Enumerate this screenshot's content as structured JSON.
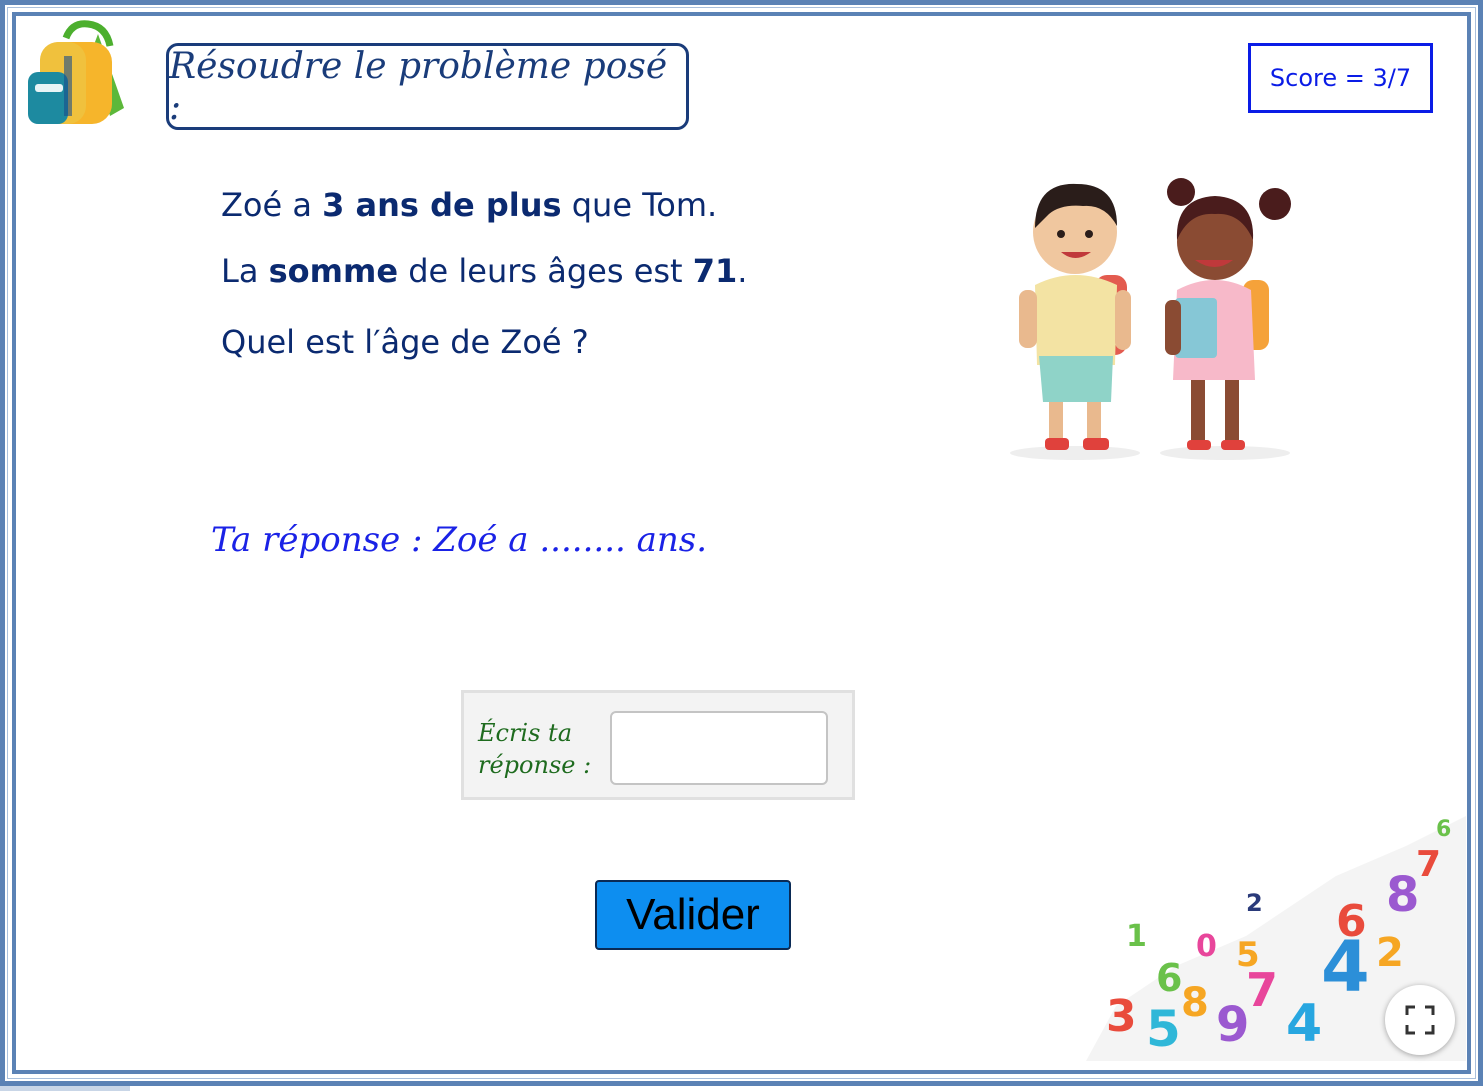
{
  "header": {
    "title": "Résoudre le problème posé :",
    "score": "Score = 3/7"
  },
  "problem": {
    "line1": {
      "part1": "Zoé a ",
      "bold1": "3 ans de plus",
      "part2": " que Tom."
    },
    "line2": {
      "part1": "La ",
      "bold1": "somme",
      "part2": " de leurs âges est ",
      "bold2": "71",
      "part3": "."
    },
    "line3": "Quel est l′âge de Zoé ?"
  },
  "answer_prompt": "Ta réponse : Zoé a ........ ans.",
  "input": {
    "label_line1": "Écris ta",
    "label_line2": "réponse :",
    "value": ""
  },
  "validate_label": "Valider",
  "icons": {
    "backpack": "backpack-icon",
    "kids": "school-kids-illustration",
    "numbers": "colorful-numbers-pile",
    "fullscreen": "fullscreen-icon"
  },
  "colors": {
    "frame": "#5b82b5",
    "title": "#1a3c7a",
    "score": "#0a1ce6",
    "problem_text": "#0b2a70",
    "answer_text": "#1a22e6",
    "label_green": "#1e6b1e",
    "button": "#0d8ef0"
  }
}
